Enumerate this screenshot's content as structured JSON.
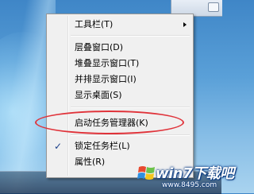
{
  "context_menu": {
    "items": [
      {
        "label": "工具栏(T)",
        "submenu": true
      },
      {
        "label": "层叠窗口(D)"
      },
      {
        "label": "堆叠显示窗口(T)"
      },
      {
        "label": "并排显示窗口(I)"
      },
      {
        "label": "显示桌面(S)"
      },
      {
        "label": "启动任务管理器(K)",
        "highlighted_by_annotation": true
      },
      {
        "label": "锁定任务栏(L)",
        "checked": true,
        "check_mark": "✓"
      },
      {
        "label": "属性(R)"
      }
    ]
  },
  "watermark": {
    "brand": "win7下载吧",
    "site": "www.8495.com"
  },
  "colors": {
    "annotation_circle": "#e0333a",
    "menu_background": "#f0f0f0",
    "desktop_blue": "#3f86c7"
  }
}
